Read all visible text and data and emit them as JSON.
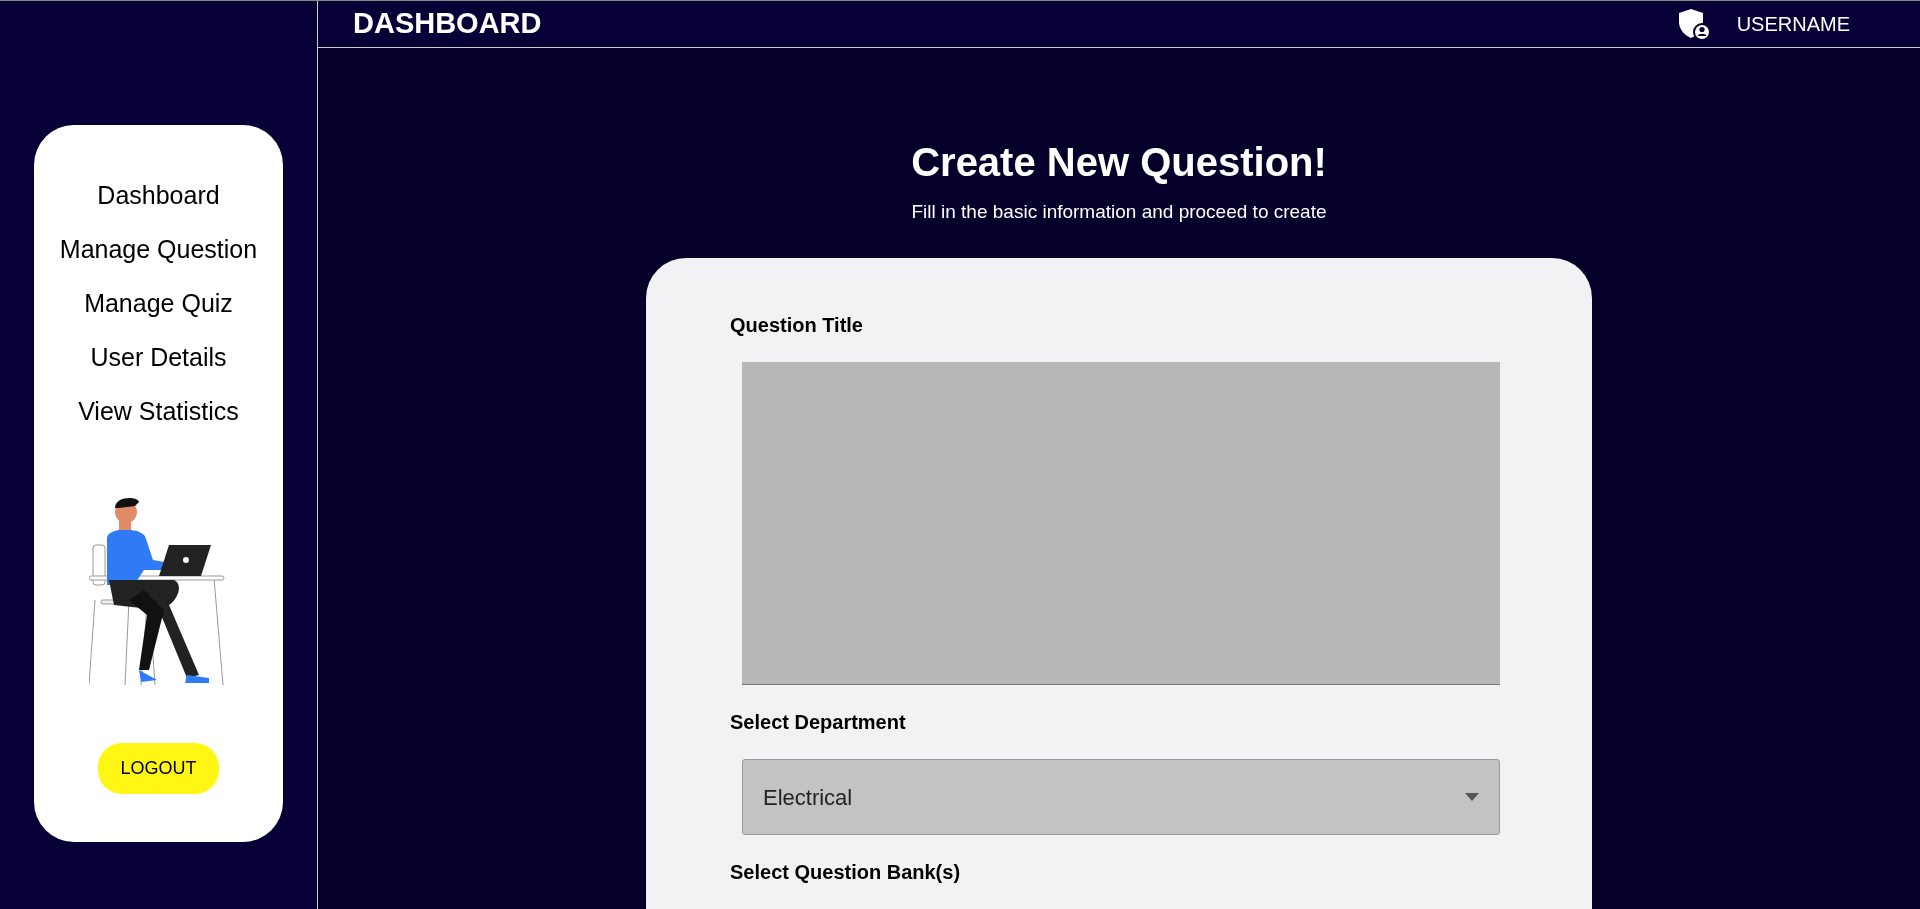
{
  "header": {
    "title": "DASHBOARD",
    "username": "USERNAME"
  },
  "sidebar": {
    "items": [
      {
        "label": "Dashboard"
      },
      {
        "label": "Manage Question"
      },
      {
        "label": "Manage Quiz"
      },
      {
        "label": "User Details"
      },
      {
        "label": "View Statistics"
      }
    ],
    "logout": "LOGOUT"
  },
  "main": {
    "heading": "Create New Question!",
    "subheading": "Fill in the basic information and proceed to create"
  },
  "form": {
    "fields": [
      {
        "kind": "textarea",
        "label": "Question Title"
      },
      {
        "kind": "select",
        "label": "Select Department",
        "value": "Electrical"
      },
      {
        "kind": "label_only",
        "label": "Select Question Bank(s)"
      }
    ]
  }
}
